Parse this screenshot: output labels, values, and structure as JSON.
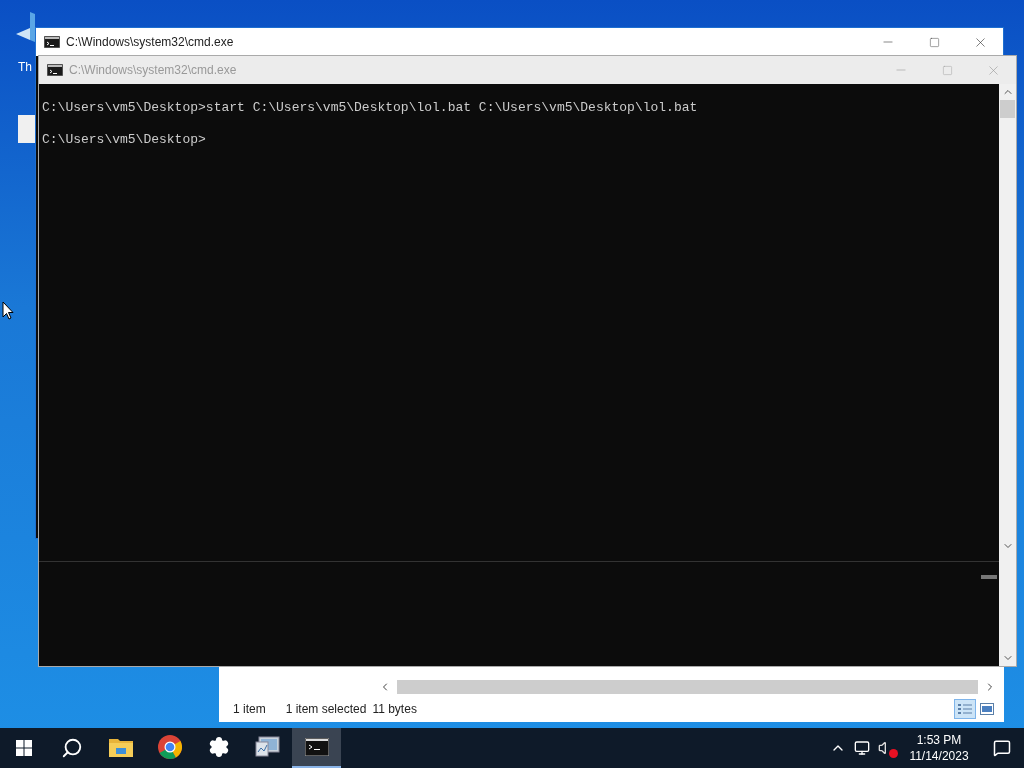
{
  "desktop": {
    "icons": [
      {
        "label": "Th"
      }
    ]
  },
  "explorer": {
    "status": [
      "1 item",
      "1 item selected",
      "11 bytes"
    ],
    "views": [
      {
        "kind": "details",
        "selected": true
      },
      {
        "kind": "preview",
        "selected": false
      }
    ]
  },
  "windows": [
    {
      "title": "C:\\Windows\\system32\\cmd.exe",
      "active": true
    },
    {
      "title": "C:\\Windows\\system32\\cmd.exe",
      "active": false,
      "lines": [
        "C:\\Users\\vm5\\Desktop>start C:\\Users\\vm5\\Desktop\\lol.bat C:\\Users\\vm5\\Desktop\\lol.bat",
        "C:\\Users\\vm5\\Desktop>"
      ]
    }
  ],
  "taskbar": {
    "apps": [
      {
        "kind": "folder",
        "selected": false
      },
      {
        "kind": "browser",
        "selected": false
      },
      {
        "kind": "settings",
        "selected": false
      },
      {
        "kind": "monitor",
        "selected": false
      },
      {
        "kind": "console",
        "selected": true
      }
    ],
    "tray": {
      "muted": true,
      "time": "1:53 PM",
      "date": "11/14/2023"
    }
  }
}
